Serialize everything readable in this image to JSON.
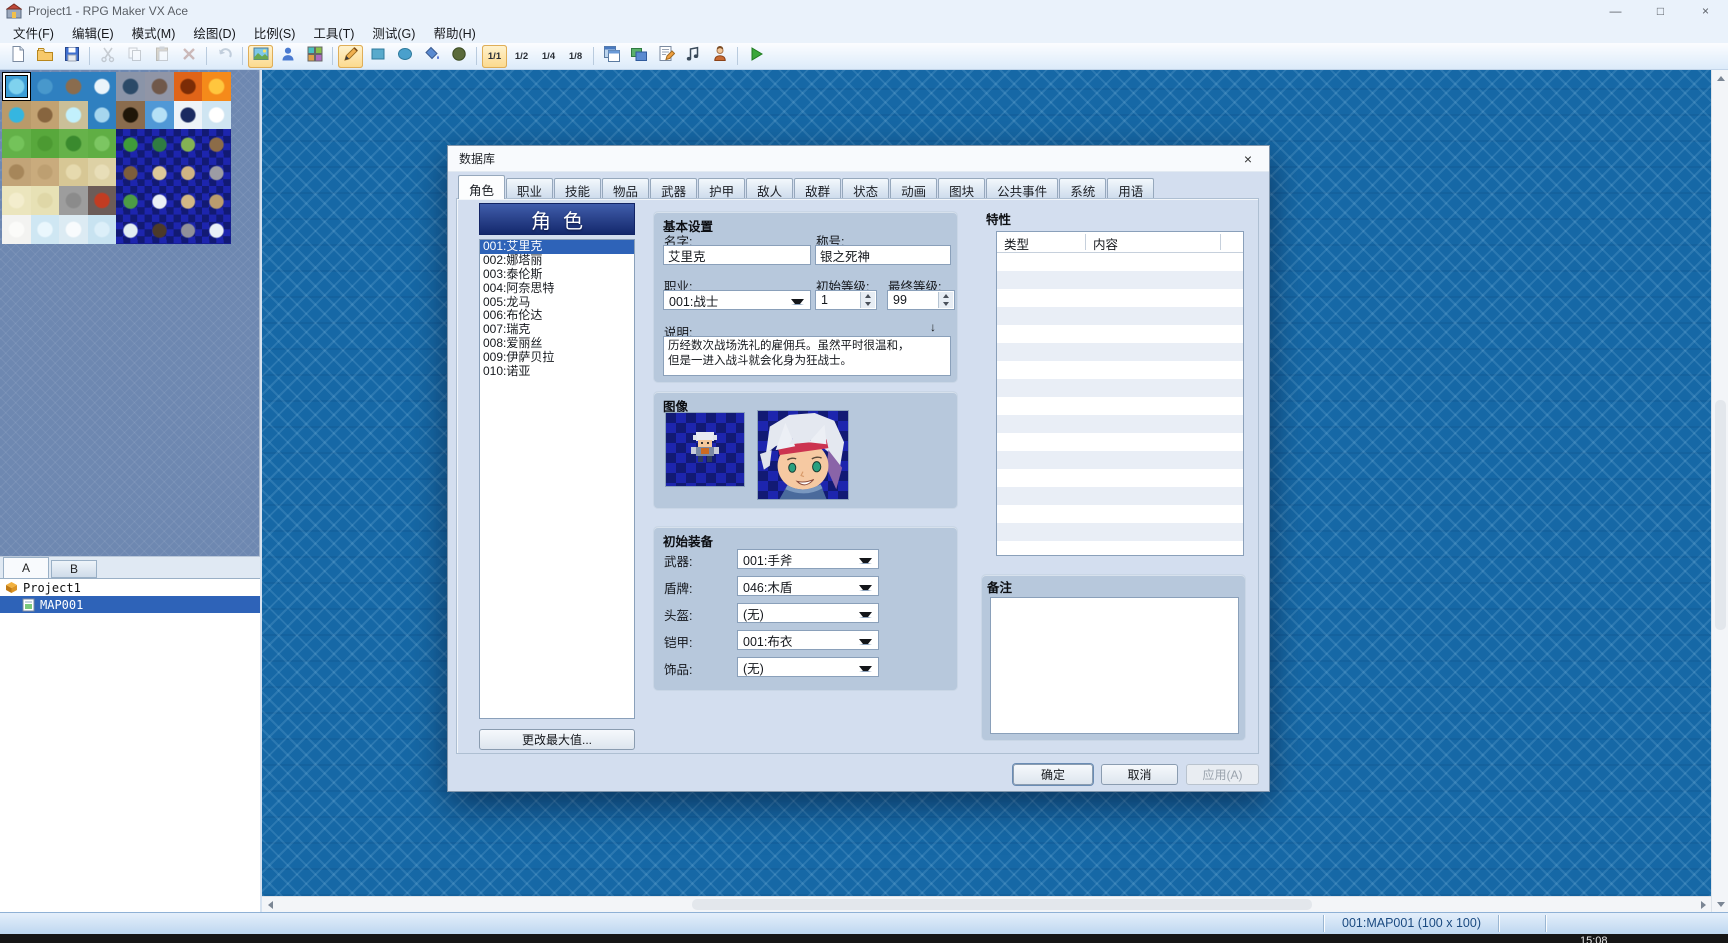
{
  "window": {
    "title": "Project1 - RPG Maker VX Ace",
    "controls": {
      "minimize": "—",
      "maximize": "□",
      "close": "×"
    }
  },
  "menu": {
    "items": [
      {
        "key": "file",
        "label": "文件(F)"
      },
      {
        "key": "edit",
        "label": "编辑(E)"
      },
      {
        "key": "mode",
        "label": "模式(M)"
      },
      {
        "key": "draw",
        "label": "绘图(D)"
      },
      {
        "key": "scale",
        "label": "比例(S)"
      },
      {
        "key": "tools",
        "label": "工具(T)"
      },
      {
        "key": "test",
        "label": "测试(G)"
      },
      {
        "key": "help",
        "label": "帮助(H)"
      }
    ]
  },
  "toolbar": {
    "groups": [
      {
        "items": [
          {
            "key": "new-project"
          },
          {
            "key": "open-project"
          },
          {
            "key": "save-project"
          }
        ]
      },
      {
        "items": [
          {
            "key": "cut",
            "disabled": true
          },
          {
            "key": "copy",
            "disabled": true
          },
          {
            "key": "paste",
            "disabled": true
          },
          {
            "key": "delete",
            "disabled": true
          }
        ]
      },
      {
        "items": [
          {
            "key": "undo",
            "disabled": true
          }
        ]
      },
      {
        "items": [
          {
            "key": "map-mode",
            "active": true
          },
          {
            "key": "event-mode"
          },
          {
            "key": "region-mode"
          }
        ]
      },
      {
        "items": [
          {
            "key": "pencil-tool",
            "active": true
          },
          {
            "key": "rectangle-tool"
          },
          {
            "key": "ellipse-tool"
          },
          {
            "key": "flood-fill-tool"
          },
          {
            "key": "shadow-pen-tool"
          }
        ]
      },
      {
        "items": [
          {
            "key": "zoom-1-1",
            "label": "1/1",
            "active": true
          },
          {
            "key": "zoom-1-2",
            "label": "1/2"
          },
          {
            "key": "zoom-1-4",
            "label": "1/4"
          },
          {
            "key": "zoom-1-8",
            "label": "1/8"
          }
        ]
      },
      {
        "items": [
          {
            "key": "database"
          },
          {
            "key": "resource-manager"
          },
          {
            "key": "script-editor"
          },
          {
            "key": "sound-test"
          },
          {
            "key": "character-generator"
          }
        ]
      },
      {
        "items": [
          {
            "key": "playtest"
          }
        ]
      }
    ]
  },
  "palette": {
    "selected_index": 0,
    "tabs": [
      {
        "label": "A",
        "active": true
      },
      {
        "label": "B",
        "active": false
      }
    ],
    "checker_colors": [
      "#1d25ae",
      "#121a74"
    ],
    "tiles": [
      [
        "water-autotile",
        "flat",
        "#3e9ed6",
        "#7fd2ee"
      ],
      [
        "sea-autotile",
        "flat",
        "#2f80c0",
        "#4898cc"
      ],
      [
        "sea-rocks",
        "flat",
        "#2f80c0",
        "#8a6c4e"
      ],
      [
        "sea-clouds",
        "flat",
        "#2f80c0",
        "#eaf4fa"
      ],
      [
        "deep-pool",
        "flat",
        "#8a94a8",
        "#2b4a68"
      ],
      [
        "gray-rocks",
        "flat",
        "#9095a6",
        "#70584a"
      ],
      [
        "lava-pool",
        "flat",
        "#e06418",
        "#7c2c06"
      ],
      [
        "lava",
        "flat",
        "#f58a1a",
        "#ffc63e"
      ],
      [
        "pond",
        "flat",
        "#b99a6a",
        "#35b6e0"
      ],
      [
        "rock-pile",
        "flat",
        "#c2a272",
        "#87653f"
      ],
      [
        "spring",
        "flat",
        "#cabf98",
        "#c2f0fc"
      ],
      [
        "whirlpool",
        "flat",
        "#2f80c0",
        "#a6d6ee"
      ],
      [
        "cave-hole",
        "flat",
        "#8a6c4e",
        "#201608"
      ],
      [
        "waterfall",
        "flat",
        "#5098d6",
        "#b4e0f6"
      ],
      [
        "snow-hole",
        "flat",
        "#eef3f8",
        "#1b2a60"
      ],
      [
        "cloud",
        "flat",
        "#cfe5f2",
        "#ffffff"
      ],
      [
        "grass",
        "flat",
        "#63b148",
        "#74c35a"
      ],
      [
        "grass-dark",
        "flat",
        "#58a83c",
        "#4c9a32"
      ],
      [
        "bush",
        "flat",
        "#66b24a",
        "#3a8a2e"
      ],
      [
        "grass-patch",
        "flat",
        "#60ae44",
        "#7cc662"
      ],
      [
        "tree",
        "obj",
        "#3f9c3a"
      ],
      [
        "pine-tree",
        "obj",
        "#2f7c42"
      ],
      [
        "green-hill",
        "obj",
        "#84b254"
      ],
      [
        "mountain",
        "obj",
        "#8c6c48"
      ],
      [
        "cracked-dirt",
        "flat",
        "#c2a478",
        "#a6865a"
      ],
      [
        "dirt",
        "flat",
        "#c9ab7d",
        "#bd9f71"
      ],
      [
        "sand-patch",
        "flat",
        "#d7c795",
        "#e6daae"
      ],
      [
        "sand",
        "flat",
        "#ddd1a5",
        "#e8deb8"
      ],
      [
        "dead-tree",
        "obj",
        "#7c5e3c"
      ],
      [
        "sand-spot",
        "obj",
        "#dcc89a"
      ],
      [
        "dunes",
        "obj",
        "#cfb484"
      ],
      [
        "gray-mountain",
        "obj",
        "#9c9ca4"
      ],
      [
        "pale-field",
        "flat",
        "#ebe5bd",
        "#f3edcd"
      ],
      [
        "pale-field-2",
        "flat",
        "#e7e1b5",
        "#dfd7a7"
      ],
      [
        "gravel",
        "flat",
        "#9d9d9d",
        "#8b8b8b"
      ],
      [
        "lava-rock",
        "flat",
        "#6c5c58",
        "#c23c22"
      ],
      [
        "palm-tree",
        "obj",
        "#4c9c46"
      ],
      [
        "white-splat",
        "obj",
        "#eaf0f6"
      ],
      [
        "sand-mound",
        "obj",
        "#d2b886"
      ],
      [
        "tan-rocks",
        "obj",
        "#bb9c6e"
      ],
      [
        "snow",
        "flat",
        "#f3f3f1",
        "#fbfbf9"
      ],
      [
        "ice",
        "flat",
        "#cfe7f3",
        "#eaf7fd"
      ],
      [
        "snow-patch",
        "flat",
        "#dcebf3",
        "#f8fbfd"
      ],
      [
        "ice-2",
        "flat",
        "#c8e3f1",
        "#dceff9"
      ],
      [
        "snow-pine",
        "obj",
        "#e2eef2"
      ],
      [
        "dark-mound",
        "obj",
        "#4c3a2a"
      ],
      [
        "rocky-mountain",
        "obj",
        "#90909a"
      ],
      [
        "snowy-mountain",
        "obj",
        "#eaf0f6"
      ]
    ]
  },
  "project_tree": {
    "root_label": "Project1",
    "items": [
      {
        "label": "MAP001",
        "selected": true
      }
    ]
  },
  "status_bar": {
    "map_info": "001:MAP001 (100 x 100)"
  },
  "taskbar": {
    "clock": "15:08"
  },
  "dialog": {
    "title": "数据库",
    "close": "×",
    "active_tab_index": 0,
    "tabs": [
      {
        "key": "actors",
        "label": "角色"
      },
      {
        "key": "classes",
        "label": "职业"
      },
      {
        "key": "skills",
        "label": "技能"
      },
      {
        "key": "items",
        "label": "物品"
      },
      {
        "key": "weapons",
        "label": "武器"
      },
      {
        "key": "armors",
        "label": "护甲"
      },
      {
        "key": "enemies",
        "label": "敌人"
      },
      {
        "key": "troops",
        "label": "敌群"
      },
      {
        "key": "states",
        "label": "状态"
      },
      {
        "key": "animations",
        "label": "动画"
      },
      {
        "key": "tilesets",
        "label": "图块"
      },
      {
        "key": "common-events",
        "label": "公共事件"
      },
      {
        "key": "system",
        "label": "系统"
      },
      {
        "key": "terms",
        "label": "用语"
      }
    ],
    "actor_list": {
      "header": "角色",
      "selected_index": 0,
      "items": [
        "001:艾里克",
        "002:娜塔丽",
        "003:泰伦斯",
        "004:阿奈思特",
        "005:龙马",
        "006:布伦达",
        "007:瑞克",
        "008:爱丽丝",
        "009:伊萨贝拉",
        "010:诺亚"
      ],
      "change_max_label": "更改最大值..."
    },
    "basic": {
      "title": "基本设置",
      "name_label": "名字:",
      "name_value": "艾里克",
      "nickname_label": "称号:",
      "nickname_value": "银之死神",
      "class_label": "职业:",
      "class_value": "001:战士",
      "init_level_label": "初始等级:",
      "init_level_value": "1",
      "max_level_label": "最终等级:",
      "max_level_value": "99",
      "desc_label": "说明:",
      "desc_arrow": "↓",
      "desc_value": "历经数次战场洗礼的雇佣兵。虽然平时很温和，\n但是一进入战斗就会化身为狂战士。"
    },
    "image_section": {
      "title": "图像"
    },
    "equipment": {
      "title": "初始装备",
      "rows": [
        {
          "key": "weapon",
          "label": "武器:",
          "value": "001:手斧"
        },
        {
          "key": "shield",
          "label": "盾牌:",
          "value": "046:木盾"
        },
        {
          "key": "helmet",
          "label": "头盔:",
          "value": "(无)"
        },
        {
          "key": "armor",
          "label": "铠甲:",
          "value": "001:布衣"
        },
        {
          "key": "accessory",
          "label": "饰品:",
          "value": "(无)"
        }
      ]
    },
    "traits": {
      "title": "特性",
      "columns": [
        "类型",
        "内容"
      ],
      "rows": []
    },
    "note": {
      "title": "备注",
      "value": ""
    },
    "buttons": {
      "ok": "确定",
      "cancel": "取消",
      "apply": "应用(A)",
      "apply_enabled": false
    }
  }
}
